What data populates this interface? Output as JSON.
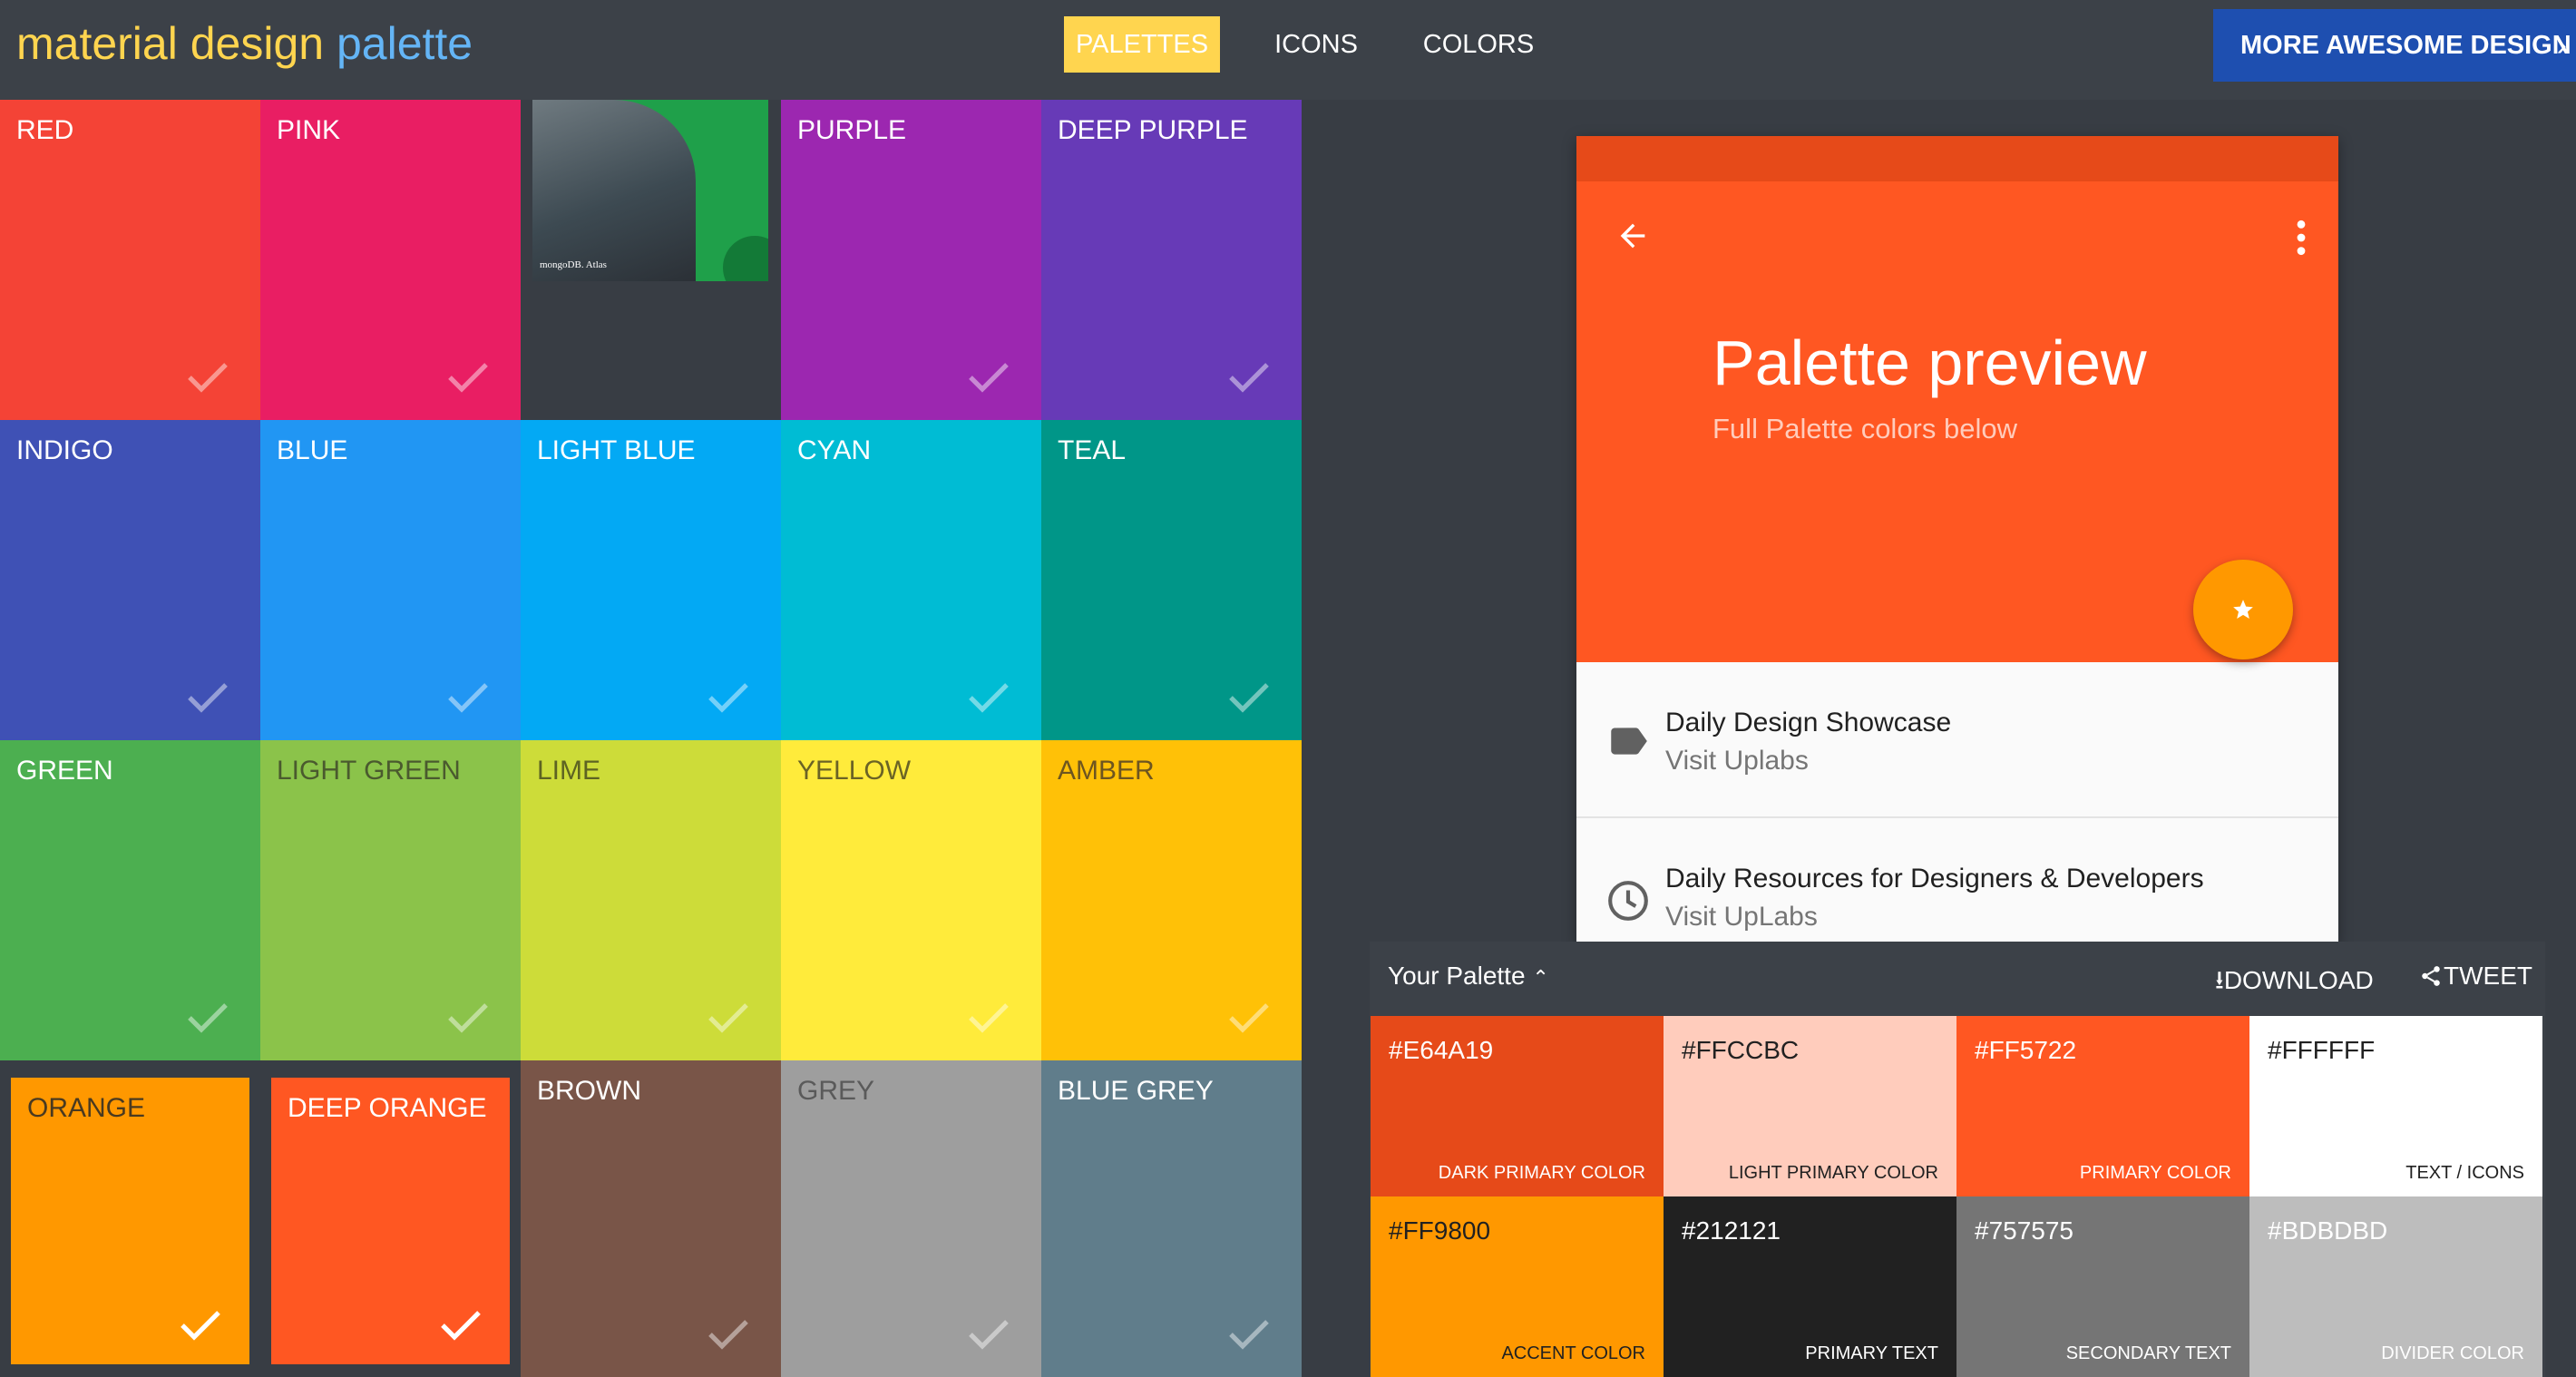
{
  "header": {
    "logo_part1": "material design",
    "logo_part2": "palette",
    "nav": [
      {
        "label": "PALETTES",
        "active": true
      },
      {
        "label": "ICONS",
        "active": false
      },
      {
        "label": "COLORS",
        "active": false
      }
    ],
    "more_button": "MORE AWESOME DESIGN"
  },
  "colors": [
    {
      "name": "RED",
      "color": "#f44336",
      "text": "#ffffff"
    },
    {
      "name": "PINK",
      "color": "#e91e63",
      "text": "#ffffff"
    },
    {
      "name": "PURPLE",
      "color": "#9c27b0",
      "text": "#ffffff"
    },
    {
      "name": "DEEP PURPLE",
      "color": "#673ab7",
      "text": "#ffffff"
    },
    {
      "name": "INDIGO",
      "color": "#3f51b5",
      "text": "#ffffff"
    },
    {
      "name": "BLUE",
      "color": "#2196f3",
      "text": "#ffffff"
    },
    {
      "name": "LIGHT BLUE",
      "color": "#03a9f4",
      "text": "#ffffff"
    },
    {
      "name": "CYAN",
      "color": "#00bcd4",
      "text": "#ffffff"
    },
    {
      "name": "TEAL",
      "color": "#009688",
      "text": "#ffffff"
    },
    {
      "name": "GREEN",
      "color": "#4caf50",
      "text": "#ffffff"
    },
    {
      "name": "LIGHT GREEN",
      "color": "#8bc34a",
      "text": "#4a5a2e"
    },
    {
      "name": "LIME",
      "color": "#cddc39",
      "text": "#5d6322"
    },
    {
      "name": "YELLOW",
      "color": "#ffeb3b",
      "text": "#6b6325"
    },
    {
      "name": "AMBER",
      "color": "#ffc107",
      "text": "#6d5520"
    },
    {
      "name": "ORANGE",
      "color": "#ff9800",
      "text": "#4a3a20",
      "selected": true
    },
    {
      "name": "DEEP ORANGE",
      "color": "#ff5722",
      "text": "#ffffff",
      "selected": true
    },
    {
      "name": "BROWN",
      "color": "#795548",
      "text": "#ffffff"
    },
    {
      "name": "GREY",
      "color": "#9e9e9e",
      "text": "#5a5a5a"
    },
    {
      "name": "BLUE GREY",
      "color": "#607d8b",
      "text": "#ffffff"
    }
  ],
  "ad": {
    "brand": "mongoDB. Atlas"
  },
  "preview": {
    "title": "Palette preview",
    "subtitle": "Full Palette colors below",
    "items": [
      {
        "title": "Daily Design Showcase",
        "subtitle": "Visit Uplabs",
        "icon": "label-icon"
      },
      {
        "title": "Daily Resources for Designers & Developers",
        "subtitle": "Visit UpLabs",
        "icon": "clock-icon"
      }
    ]
  },
  "palette_panel": {
    "title": "Your Palette",
    "download": "DOWNLOAD",
    "tweet": "TWEET",
    "swatches": [
      {
        "hex": "#E64A19",
        "role": "DARK PRIMARY COLOR",
        "bg": "#e64a19",
        "fg": "#ffffff"
      },
      {
        "hex": "#FFCCBC",
        "role": "LIGHT PRIMARY COLOR",
        "bg": "#ffccbc",
        "fg": "#212121"
      },
      {
        "hex": "#FF5722",
        "role": "PRIMARY COLOR",
        "bg": "#ff5722",
        "fg": "#ffffff"
      },
      {
        "hex": "#FFFFFF",
        "role": "TEXT / ICONS",
        "bg": "#ffffff",
        "fg": "#212121"
      },
      {
        "hex": "#FF9800",
        "role": "ACCENT COLOR",
        "bg": "#ff9800",
        "fg": "#212121"
      },
      {
        "hex": "#212121",
        "role": "PRIMARY TEXT",
        "bg": "#212121",
        "fg": "#ffffff"
      },
      {
        "hex": "#757575",
        "role": "SECONDARY TEXT",
        "bg": "#757575",
        "fg": "#ffffff"
      },
      {
        "hex": "#BDBDBD",
        "role": "DIVIDER COLOR",
        "bg": "#bdbdbd",
        "fg": "#ffffff"
      }
    ]
  }
}
